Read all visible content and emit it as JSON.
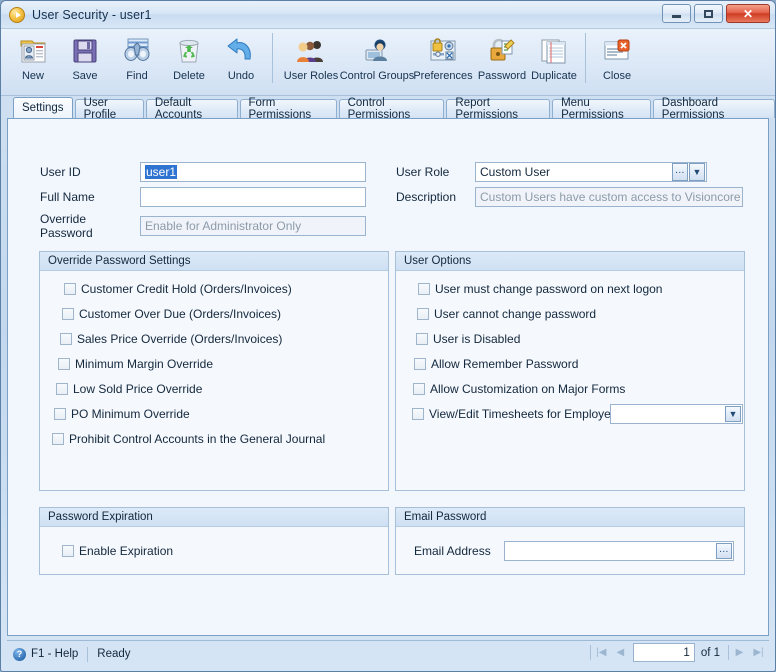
{
  "window": {
    "title": "User Security - user1",
    "app_icon": "play-circle-icon",
    "controls": {
      "minimize": "minimize-icon",
      "maximize": "maximize-icon",
      "close": "close-icon"
    }
  },
  "toolbar": {
    "items": [
      {
        "label": "New",
        "icon": "new-record-icon"
      },
      {
        "label": "Save",
        "icon": "floppy-disk-icon"
      },
      {
        "label": "Find",
        "icon": "binoculars-icon"
      },
      {
        "label": "Delete",
        "icon": "recycle-bin-icon"
      },
      {
        "label": "Undo",
        "icon": "undo-arrow-icon"
      },
      {
        "label": "User Roles",
        "icon": "users-group-icon"
      },
      {
        "label": "Control Groups",
        "icon": "computer-user-icon"
      },
      {
        "label": "Preferences",
        "icon": "lock-settings-icon"
      },
      {
        "label": "Password",
        "icon": "padlock-key-icon"
      },
      {
        "label": "Duplicate",
        "icon": "duplicate-pages-icon"
      },
      {
        "label": "Close",
        "icon": "close-window-icon"
      }
    ]
  },
  "tabs": [
    {
      "label": "Settings",
      "active": true
    },
    {
      "label": "User Profile",
      "active": false
    },
    {
      "label": "Default Accounts",
      "active": false
    },
    {
      "label": "Form Permissions",
      "active": false
    },
    {
      "label": "Control Permissions",
      "active": false
    },
    {
      "label": "Report Permissions",
      "active": false
    },
    {
      "label": "Menu Permissions",
      "active": false
    },
    {
      "label": "Dashboard Permissions",
      "active": false
    }
  ],
  "form": {
    "user_id": {
      "label": "User ID",
      "value": "user1",
      "selected": true
    },
    "full_name": {
      "label": "Full Name",
      "value": ""
    },
    "override_password": {
      "label": "Override Password",
      "value": "",
      "placeholder": "Enable for Administrator Only"
    },
    "user_role": {
      "label": "User Role",
      "value": "Custom User",
      "ellipsis": "…",
      "chevron": "chevron-down-icon"
    },
    "description": {
      "label": "Description",
      "value": "Custom Users have custom access to Visioncore"
    }
  },
  "override_password_settings": {
    "title": "Override Password Settings",
    "checkboxes": [
      {
        "label": "Customer Credit Hold (Orders/Invoices)",
        "checked": false
      },
      {
        "label": "Customer Over Due (Orders/Invoices)",
        "checked": false
      },
      {
        "label": "Sales Price Override (Orders/Invoices)",
        "checked": false
      },
      {
        "label": "Minimum Margin Override",
        "checked": false
      },
      {
        "label": "Low Sold Price Override",
        "checked": false
      },
      {
        "label": "PO Minimum Override",
        "checked": false
      },
      {
        "label": "Prohibit Control Accounts in the General Journal",
        "checked": false
      }
    ]
  },
  "user_options": {
    "title": "User Options",
    "checkboxes": [
      {
        "label": "User must change password on next logon",
        "checked": false
      },
      {
        "label": "User cannot change password",
        "checked": false
      },
      {
        "label": "User is Disabled",
        "checked": false
      },
      {
        "label": "Allow Remember Password",
        "checked": false
      },
      {
        "label": "Allow Customization on Major Forms",
        "checked": false
      },
      {
        "label": "View/Edit Timesheets for Employee",
        "checked": false
      }
    ],
    "timesheet_combo": {
      "value": "",
      "chevron": "chevron-down-icon"
    }
  },
  "password_expiration": {
    "title": "Password Expiration",
    "enable": {
      "label": "Enable Expiration",
      "checked": false
    }
  },
  "email_password": {
    "title": "Email Password",
    "email_address": {
      "label": "Email Address",
      "value": "",
      "ellipsis": "…"
    }
  },
  "statusbar": {
    "help": "F1 - Help",
    "help_icon": "question-mark-icon",
    "status": "Ready",
    "nav": {
      "first": "first-page-icon",
      "prev": "previous-page-icon",
      "page": "1",
      "of": "of 1",
      "next": "next-page-icon",
      "last": "last-page-icon"
    }
  },
  "colors": {
    "accent": "#2f74d0",
    "titlebar": "#d7e6f6",
    "content_bg": "#f2f6fd",
    "group_header": "#d4e4f6",
    "close_button": "#cf3c22"
  }
}
